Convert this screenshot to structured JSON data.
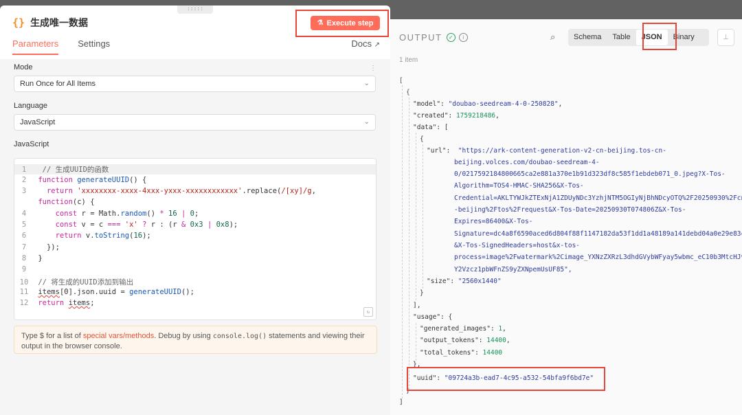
{
  "node": {
    "icon": "{}",
    "title": "生成唯一数据",
    "execute_label": "Execute step"
  },
  "tabs": {
    "parameters": "Parameters",
    "settings": "Settings",
    "docs": "Docs"
  },
  "fields": {
    "mode_label": "Mode",
    "mode_value": "Run Once for All Items",
    "language_label": "Language",
    "language_value": "JavaScript",
    "code_label": "JavaScript"
  },
  "code": {
    "line_numbers": [
      "1",
      "2",
      "3",
      "4",
      "5",
      "6",
      "7",
      "8",
      "9",
      "10",
      "11",
      "12"
    ],
    "l1_comment": "// 生成UUID的函数",
    "fn_kw": "function",
    "fn_name": "generateUUID",
    "fn_rest": "() {",
    "ret": "return",
    "tmpl": "'xxxxxxxx-xxxx-4xxx-yxxx-xxxxxxxxxxxx'",
    "replace": ".replace(",
    "regex": "/[xy]/g",
    "replace_end": ",",
    "l3b_fn": "function",
    "l3b_rest": "(c) {",
    "const": "const",
    "r_assign": "r = Math.",
    "random": "random",
    "r_rest": "() ",
    "star": "*",
    "sixteen": "16",
    "pipe": "|",
    "zero": "0",
    "semi": ";",
    "v_assign": "v = c ",
    "eq": "===",
    "xq": "'x'",
    "tern": "?",
    "r_colon": "r : (r ",
    "amp": "&",
    "h3": "0x3",
    "h8": "0x8",
    "v_end": ");",
    "v_ret": "v.",
    "tostr": "toString",
    "tostr_arg": "16",
    "tostr_end": ");",
    "close_fn": "});",
    "close_brace": "}",
    "l10_comment": "// 将生成的UUID添加到输出",
    "items": "items",
    "l11_mid": "[0].json.uuid = ",
    "l11_fn": "generateUUID",
    "l11_end": "();",
    "l12_items": "items",
    "l12_end": ";"
  },
  "hint": {
    "pre": "Type $ for a list of ",
    "link": "special vars/methods",
    "mid": ". Debug by using ",
    "code": "console.log()",
    "post": " statements and viewing their output in the browser console."
  },
  "output": {
    "title": "OUTPUT",
    "view_tabs": [
      "Schema",
      "Table",
      "JSON",
      "Binary"
    ],
    "item_count": "1 item"
  },
  "json": {
    "model_key": "\"model\"",
    "model_val": "\"doubao-seedream-4-0-250828\"",
    "created_key": "\"created\"",
    "created_val": "1759218486",
    "data_key": "\"data\"",
    "url_key": "\"url\"",
    "url_lines": [
      "\"https://ark-content-generation-v2-cn-beijing.tos-cn-",
      "beijing.volces.com/doubao-seedream-4-",
      "0/0217592184800665ca2e881a370e1b91d323df8c585f1ebdeb071_0.jpeg?X-Tos-",
      "Algorithm=TOS4-HMAC-SHA256&X-Tos-",
      "Credential=AKLTYWJkZTExNjA1ZDUyNDc3YzhjNTM5OGIyNjBhNDcyOTQ%2F20250930%2Fcn",
      "-beijing%2Ftos%2Frequest&X-Tos-Date=20250930T074806Z&X-Tos-",
      "Expires=86400&X-Tos-",
      "Signature=dc4a8f6590aced6d804f88f1147182da53f1dd1a48189a141debd04a0e29e83c",
      "&X-Tos-SignedHeaders=host&x-tos-",
      "process=image%2Fwatermark%2Cimage_YXNzZXRzL3dhdGVybWFyay5wbmc_eC10b3MtcHJv",
      "Y2Vzcz1pbWFnZS9yZXNpemUsUF85\","
    ],
    "size_key": "\"size\"",
    "size_val": "\"2560x1440\"",
    "usage_key": "\"usage\"",
    "gen_key": "\"generated_images\"",
    "gen_val": "1",
    "out_key": "\"output_tokens\"",
    "out_val": "14400",
    "tot_key": "\"total_tokens\"",
    "tot_val": "14400",
    "uuid_key": "\"uuid\"",
    "uuid_val": "\"09724a3b-ead7-4c95-a532-54bfa9f6bd7e\""
  }
}
